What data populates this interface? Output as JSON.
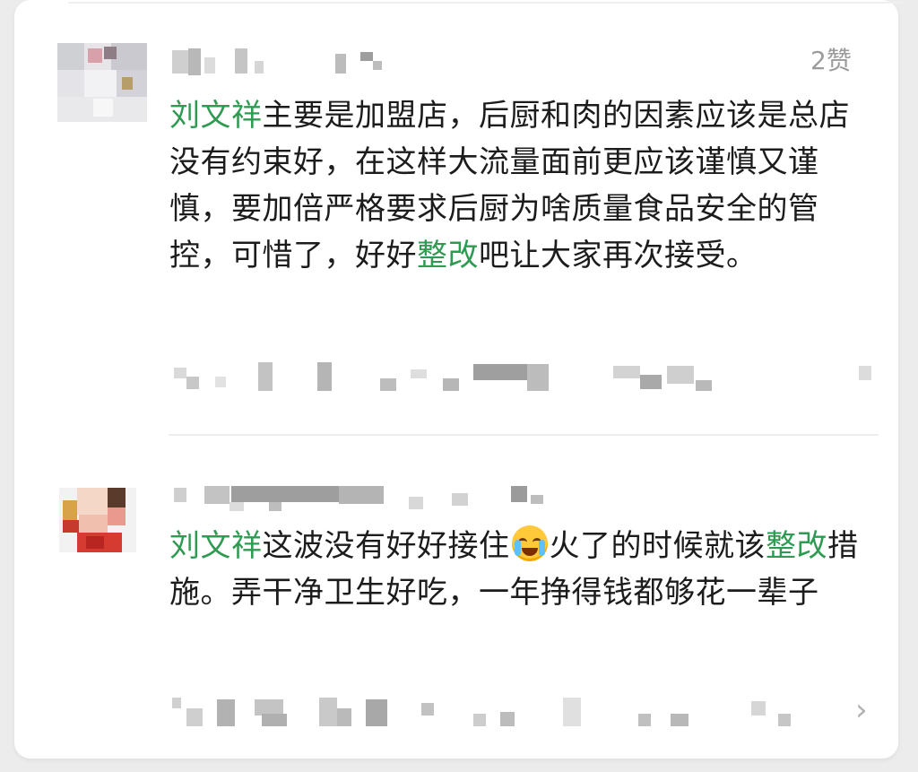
{
  "comments": [
    {
      "mention": "刘文祥",
      "text_before": "主要是加盟店，后厨和肉的因素应该是总店没有约束好，在这样大流量面前更应该谨慎又谨慎，要加倍严格要求后厨为啥质量食品安全的管控，可惜了，好好",
      "keyword": "整改",
      "text_after": "吧让大家再次接受。",
      "likes": "2赞"
    },
    {
      "mention": "刘文祥",
      "text_before": "这波没有好好接住",
      "emoji": "loudly-crying-face",
      "text_mid": "火了的时候就该",
      "keyword": "整改",
      "text_after": "措施。弄干净卫生好吃，一年挣得钱都够花一辈子"
    }
  ],
  "colors": {
    "mention": "#2f9a52",
    "text": "#1c1c1c",
    "meta": "#9b9b9b",
    "card": "#ffffff",
    "background": "#ececec"
  },
  "icons": {
    "chevron": "chevron-right-icon"
  },
  "chevron_glyph": "›"
}
